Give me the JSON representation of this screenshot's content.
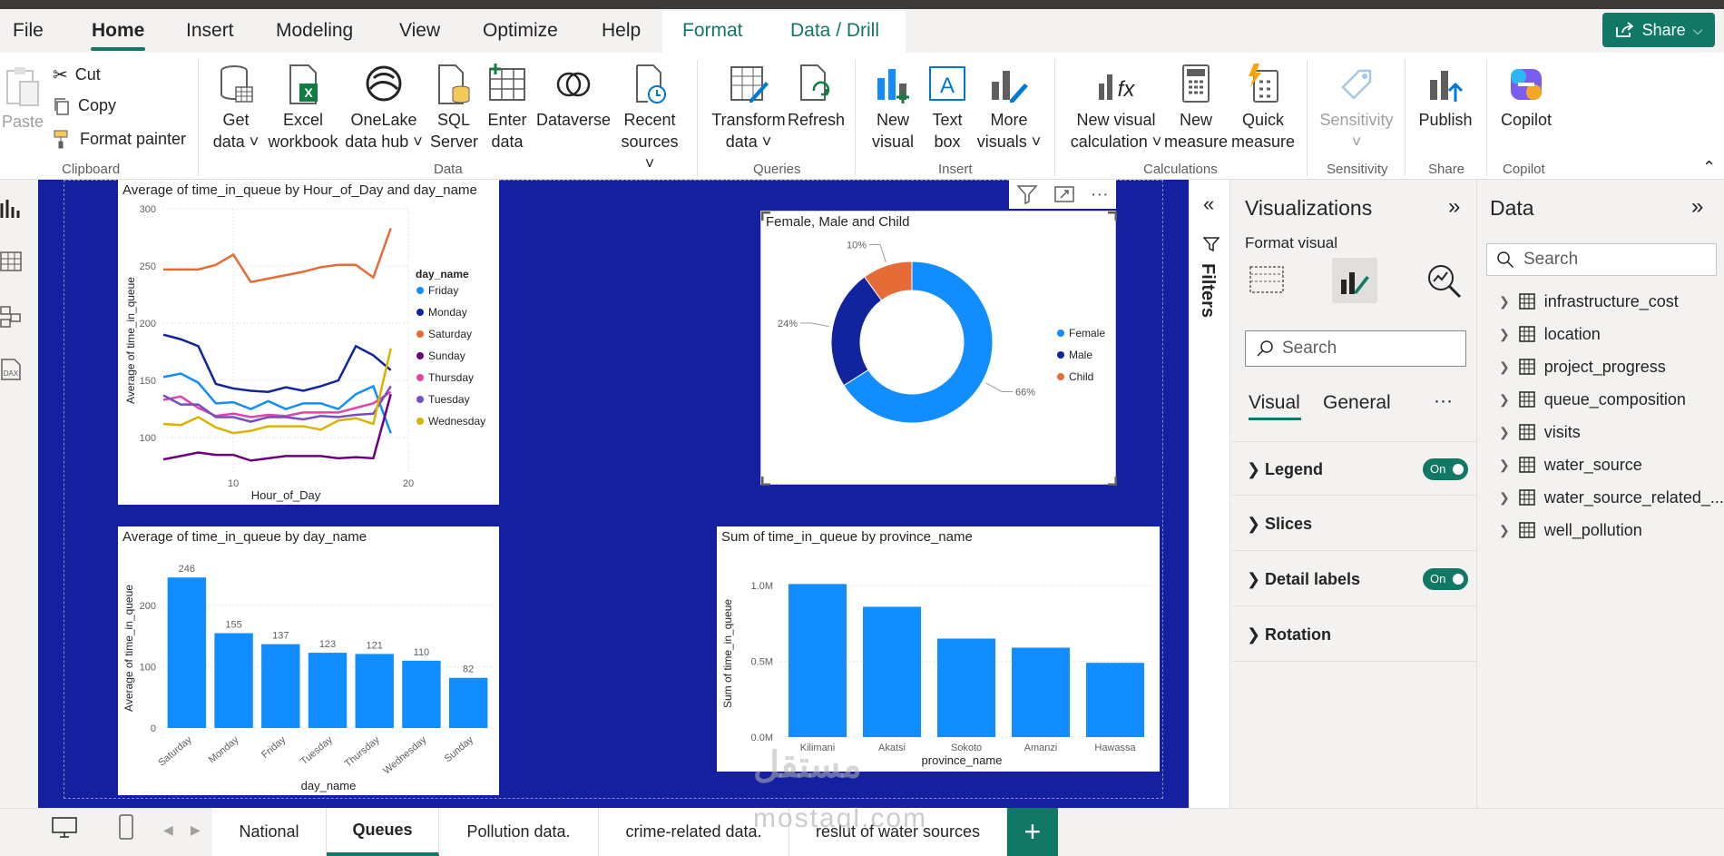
{
  "menu": {
    "tabs": [
      "File",
      "Home",
      "Insert",
      "Modeling",
      "View",
      "Optimize",
      "Help",
      "Format",
      "Data / Drill"
    ],
    "share_label": "Share"
  },
  "ribbon": {
    "clipboard": {
      "paste": "Paste",
      "cut": "Cut",
      "copy": "Copy",
      "format_painter": "Format painter",
      "label": "Clipboard"
    },
    "data": {
      "get_data": [
        "Get",
        "data"
      ],
      "excel": [
        "Excel",
        "workbook"
      ],
      "onelake": [
        "OneLake",
        "data hub"
      ],
      "sql": [
        "SQL",
        "Server"
      ],
      "enter": [
        "Enter",
        "data"
      ],
      "dataverse": "Dataverse",
      "recent": [
        "Recent",
        "sources"
      ],
      "label": "Data"
    },
    "queries": {
      "transform": [
        "Transform",
        "data"
      ],
      "refresh": "Refresh",
      "label": "Queries"
    },
    "insert": {
      "new_visual": [
        "New",
        "visual"
      ],
      "text_box": [
        "Text",
        "box"
      ],
      "more_visuals": [
        "More",
        "visuals"
      ],
      "label": "Insert"
    },
    "calculations": {
      "new_visual_calc": [
        "New visual",
        "calculation"
      ],
      "new_measure": [
        "New",
        "measure"
      ],
      "quick_measure": [
        "Quick",
        "measure"
      ],
      "label": "Calculations"
    },
    "sensitivity": {
      "btn": "Sensitivity",
      "label": "Sensitivity"
    },
    "share": {
      "publish": "Publish",
      "label": "Share"
    },
    "copilot": {
      "btn": "Copilot",
      "label": "Copilot"
    }
  },
  "filters_label": "Filters",
  "visualizations": {
    "title": "Visualizations",
    "format_visual": "Format visual",
    "search_placeholder": "Search",
    "tabs": [
      "Visual",
      "General"
    ],
    "more": "···",
    "sections": [
      {
        "label": "Legend",
        "toggle": "On"
      },
      {
        "label": "Slices",
        "toggle": ""
      },
      {
        "label": "Detail labels",
        "toggle": "On"
      },
      {
        "label": "Rotation",
        "toggle": ""
      }
    ]
  },
  "data_pane": {
    "title": "Data",
    "search_placeholder": "Search",
    "tables": [
      "infrastructure_cost",
      "location",
      "project_progress",
      "queue_composition",
      "visits",
      "water_source",
      "water_source_related_...",
      "well_pollution"
    ]
  },
  "page_tabs": [
    "National",
    "Queues",
    "Pollution data.",
    "crime-related data.",
    "reslut of water sources"
  ],
  "watermark": {
    "arabic": "مستقل",
    "latin": "mostaql.com"
  },
  "chart_data": [
    {
      "type": "line",
      "title": "Average of time_in_queue by Hour_of_Day and day_name",
      "xlabel": "Hour_of_Day",
      "ylabel": "Average of time_in_queue",
      "legend_title": "day_name",
      "xlim": [
        6,
        20
      ],
      "ylim": [
        70,
        300
      ],
      "yticks": [
        100,
        150,
        200,
        250,
        300
      ],
      "xticks": [
        10,
        20
      ],
      "x": [
        6,
        7,
        8,
        9,
        10,
        11,
        12,
        13,
        14,
        15,
        16,
        17,
        18,
        19
      ],
      "series": [
        {
          "name": "Friday",
          "color": "#118DFF",
          "values": [
            153,
            156,
            148,
            130,
            131,
            125,
            132,
            125,
            130,
            130,
            125,
            138,
            145,
            104
          ]
        },
        {
          "name": "Monday",
          "color": "#12239E",
          "values": [
            190,
            186,
            180,
            147,
            143,
            141,
            140,
            144,
            141,
            145,
            150,
            180,
            172,
            159
          ]
        },
        {
          "name": "Saturday",
          "color": "#E66C37",
          "values": [
            247,
            247,
            247,
            251,
            260,
            236,
            239,
            242,
            245,
            249,
            251,
            251,
            240,
            283
          ]
        },
        {
          "name": "Sunday",
          "color": "#6B007B",
          "values": [
            81,
            84,
            87,
            85,
            85,
            80,
            82,
            84,
            84,
            84,
            82,
            83,
            82,
            138
          ]
        },
        {
          "name": "Thursday",
          "color": "#E044A7",
          "values": [
            133,
            136,
            126,
            119,
            121,
            118,
            120,
            119,
            122,
            122,
            122,
            126,
            130,
            140
          ]
        },
        {
          "name": "Tuesday",
          "color": "#744EC2",
          "values": [
            137,
            129,
            129,
            118,
            118,
            114,
            118,
            118,
            116,
            119,
            118,
            120,
            121,
            145
          ]
        },
        {
          "name": "Wednesday",
          "color": "#D9B300",
          "values": [
            112,
            111,
            118,
            109,
            104,
            106,
            110,
            110,
            110,
            107,
            115,
            117,
            112,
            178
          ]
        }
      ]
    },
    {
      "type": "pie",
      "title": "Female, Male and Child",
      "categories": [
        "Female",
        "Male",
        "Child"
      ],
      "values": [
        66,
        24,
        10
      ],
      "labels": [
        "66%",
        "24%",
        "10%"
      ],
      "colors": [
        "#118DFF",
        "#12239E",
        "#E66C37"
      ]
    },
    {
      "type": "bar",
      "title": "Average of time_in_queue by day_name",
      "xlabel": "day_name",
      "ylabel": "Average of time_in_queue",
      "categories": [
        "Saturday",
        "Monday",
        "Friday",
        "Tuesday",
        "Thursday",
        "Wednesday",
        "Sunday"
      ],
      "values": [
        246,
        155,
        137,
        123,
        121,
        110,
        82
      ],
      "ylim": [
        0,
        270
      ],
      "yticks": [
        0,
        100,
        200
      ]
    },
    {
      "type": "bar",
      "title": "Sum of time_in_queue by province_name",
      "xlabel": "province_name",
      "ylabel": "Sum of time_in_queue",
      "categories": [
        "Kilimani",
        "Akatsi",
        "Sokoto",
        "Amanzi",
        "Hawassa"
      ],
      "values": [
        1.01,
        0.86,
        0.65,
        0.59,
        0.49
      ],
      "value_unit": "M",
      "ylim": [
        0,
        1.15
      ],
      "yticks": [
        0,
        0.5,
        1.0
      ],
      "ytick_labels": [
        "0.0M",
        "0.5M",
        "1.0M"
      ]
    }
  ]
}
